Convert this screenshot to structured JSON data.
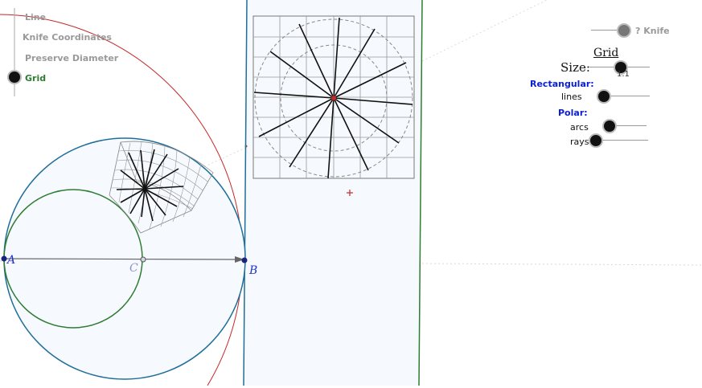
{
  "menu": {
    "items": [
      {
        "label": "Line",
        "active": false
      },
      {
        "label": "Knife Coordinates",
        "active": false
      },
      {
        "label": "Preserve Diameter",
        "active": false
      },
      {
        "label": "Grid",
        "active": true
      }
    ]
  },
  "knife_toggle": {
    "label": "? Knife"
  },
  "grid_panel": {
    "title": "Grid",
    "size_label": "Size:",
    "size_value": "1.1",
    "rect_heading": "Rectangular:",
    "lines_label": "lines",
    "polar_heading": "Polar:",
    "arcs_label": "arcs",
    "rays_label": "rays"
  },
  "points": {
    "a": "A",
    "b": "B",
    "c": "C"
  },
  "colors": {
    "blue_circle": "#1f6e99",
    "green_circle": "#2e7d32",
    "red_arc": "#c62828",
    "strip_fill": "#f6f9fd",
    "accent_blue": "#0a1fd1"
  }
}
